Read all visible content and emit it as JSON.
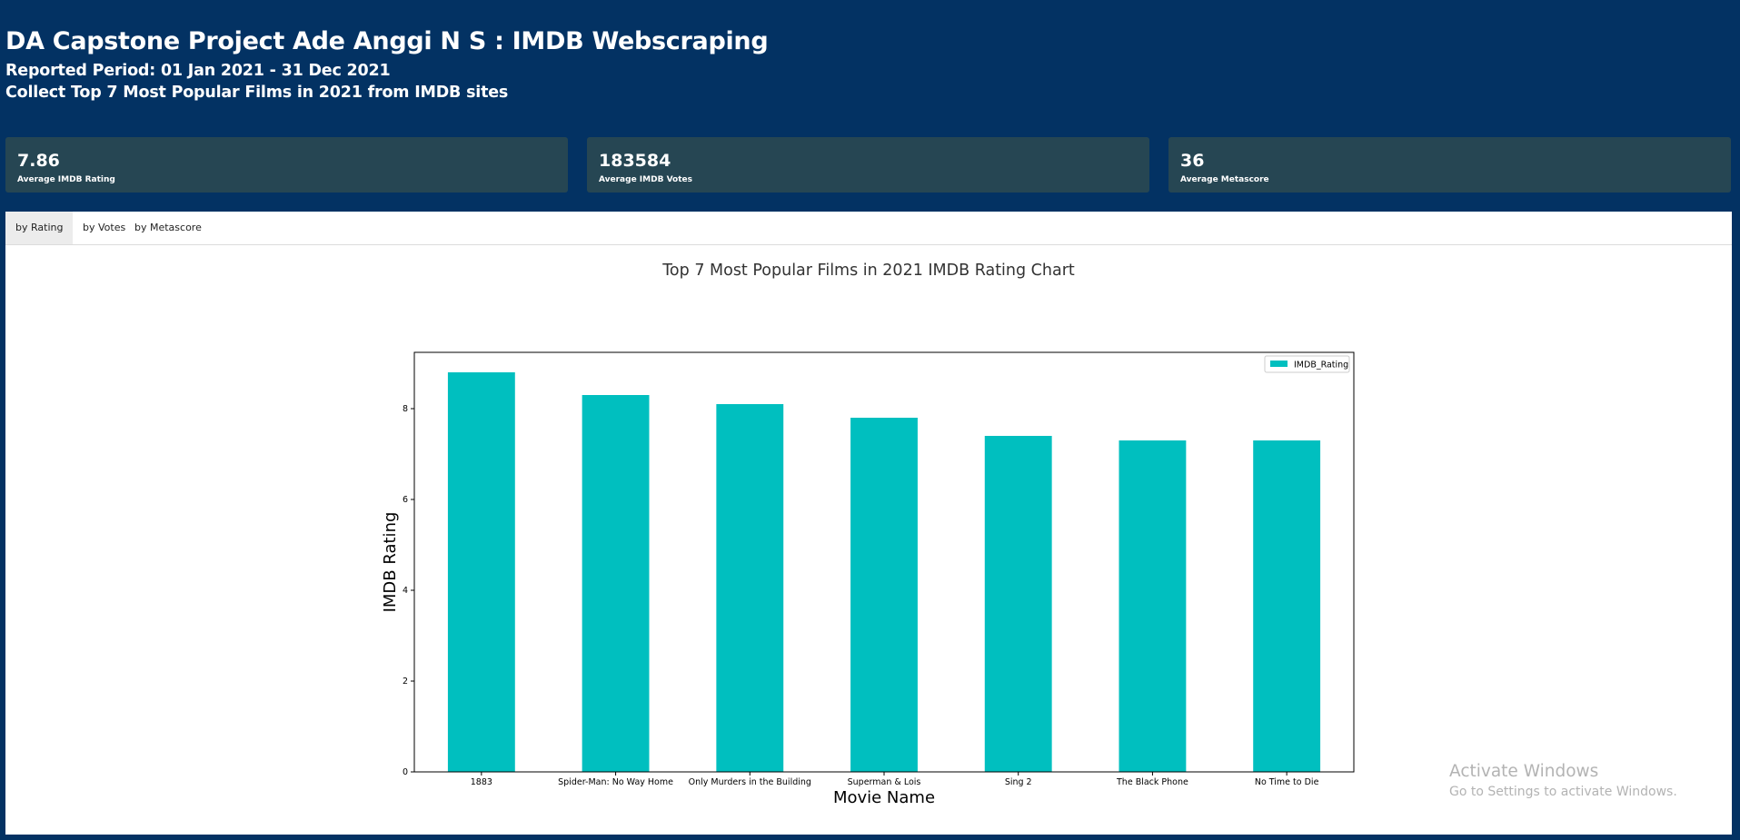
{
  "header": {
    "title": "DA Capstone Project Ade Anggi N S : IMDB Webscraping",
    "period": "Reported Period: 01 Jan 2021 - 31 Dec 2021",
    "description": "Collect Top 7 Most Popular Films in 2021 from IMDB sites"
  },
  "cards": [
    {
      "value": "7.86",
      "label": "Average IMDB Rating"
    },
    {
      "value": "183584",
      "label": "Average IMDB Votes"
    },
    {
      "value": "36",
      "label": "Average Metascore"
    }
  ],
  "tabs": [
    {
      "label": "by Rating",
      "active": true
    },
    {
      "label": "by Votes",
      "active": false
    },
    {
      "label": "by Metascore",
      "active": false
    }
  ],
  "chart_title": "Top 7 Most Popular Films in 2021 IMDB Rating Chart",
  "chart_data": {
    "type": "bar",
    "categories": [
      "1883",
      "Spider-Man: No Way Home",
      "Only Murders in the Building",
      "Superman & Lois",
      "Sing 2",
      "The Black Phone",
      "No Time to Die"
    ],
    "series": [
      {
        "name": "IMDB_Rating",
        "values": [
          8.8,
          8.3,
          8.1,
          7.8,
          7.4,
          7.3,
          7.3
        ]
      }
    ],
    "xlabel": "Movie Name",
    "ylabel": "IMDB Rating",
    "ylim": [
      0,
      9.24
    ],
    "yticks": [
      0,
      2,
      4,
      6,
      8
    ],
    "legend": "top-right",
    "grid": false,
    "bar_color": "#00bfbf"
  },
  "watermark": {
    "line1": "Activate Windows",
    "line2": "Go to Settings to activate Windows."
  },
  "colors": {
    "background": "#033263",
    "card": "#264653",
    "bar": "#00bfbf"
  }
}
